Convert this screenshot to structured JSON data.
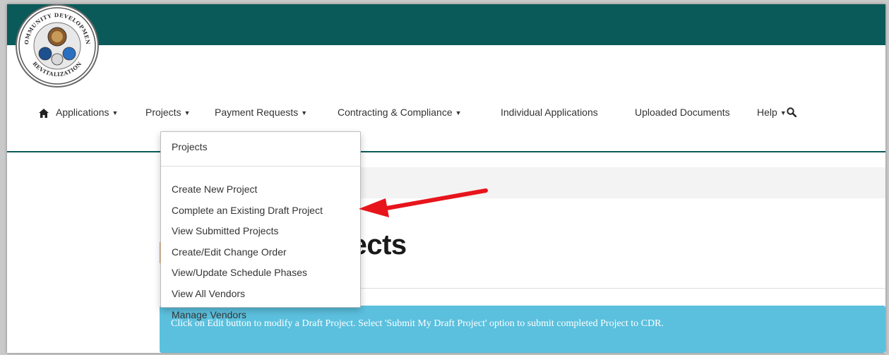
{
  "header": {
    "logo": {
      "ring_text_top": "COMMUNITY DEVELOPMENT",
      "ring_text_bottom": "REVITALIZATION"
    },
    "brand_color": "#0b5a5a"
  },
  "nav": {
    "home_icon": "home-icon",
    "items": [
      {
        "label": "Applications",
        "has_dropdown": true
      },
      {
        "label": "Projects",
        "has_dropdown": true
      },
      {
        "label": "Payment Requests",
        "has_dropdown": true
      },
      {
        "label": "Contracting & Compliance",
        "has_dropdown": true
      },
      {
        "label": "Individual Applications",
        "has_dropdown": false
      },
      {
        "label": "Uploaded Documents",
        "has_dropdown": false
      },
      {
        "label": "Help",
        "has_dropdown": true
      }
    ],
    "search_icon": "search-icon"
  },
  "projects_menu": {
    "header": "Projects",
    "items": [
      "Create New Project",
      "Complete an Existing Draft Project",
      "View Submitted Projects",
      "Create/Edit Change Order",
      "View/Update Schedule Phases",
      "View All Vendors",
      "Manage Vendors"
    ],
    "highlighted_item": "Complete an Existing Draft Project"
  },
  "page": {
    "title_visible": "jects",
    "info": "Click on Edit button to modify a Draft Project. Select 'Submit My Draft Project' option to submit completed Project to CDR."
  },
  "annotation": {
    "arrow_color": "#e8141b"
  }
}
